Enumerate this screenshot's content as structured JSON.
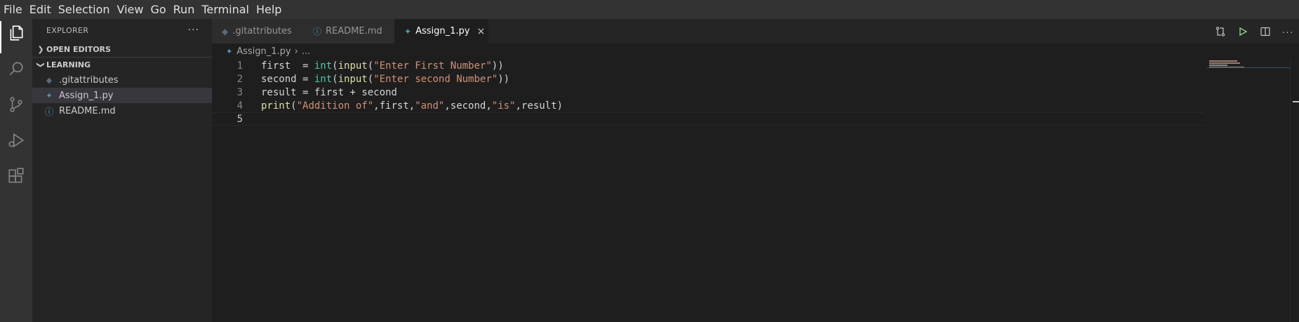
{
  "menubar": {
    "items": [
      "File",
      "Edit",
      "Selection",
      "View",
      "Go",
      "Run",
      "Terminal",
      "Help"
    ]
  },
  "activitybar": {
    "items": [
      "explorer-icon",
      "search-icon",
      "source-control-icon",
      "run-debug-icon",
      "extensions-icon"
    ]
  },
  "sidebar": {
    "title": "EXPLORER",
    "more": "···",
    "open_editors": "OPEN EDITORS",
    "folder": "LEARNING",
    "files": [
      {
        "name": ".gitattributes",
        "icon": "git-file-icon",
        "selected": false
      },
      {
        "name": "Assign_1.py",
        "icon": "python-file-icon",
        "selected": true
      },
      {
        "name": "README.md",
        "icon": "info-file-icon",
        "selected": false
      }
    ]
  },
  "tabs": [
    {
      "label": ".gitattributes",
      "icon": "git-file-icon",
      "active": false
    },
    {
      "label": "README.md",
      "icon": "info-file-icon",
      "active": false
    },
    {
      "label": "Assign_1.py",
      "icon": "python-file-icon",
      "active": true,
      "close": "×"
    }
  ],
  "tab_actions": [
    "compare-changes-icon",
    "run-icon",
    "split-editor-icon",
    "more-actions-icon"
  ],
  "breadcrumb": {
    "file": "Assign_1.py",
    "separator": "›",
    "rest": "..."
  },
  "editor": {
    "lines": [
      {
        "num": "1",
        "tokens": [
          {
            "t": "first  = ",
            "c": "plain"
          },
          {
            "t": "int",
            "c": "builtin"
          },
          {
            "t": "(",
            "c": "plain"
          },
          {
            "t": "input",
            "c": "fn"
          },
          {
            "t": "(",
            "c": "plain"
          },
          {
            "t": "\"Enter First Number\"",
            "c": "str"
          },
          {
            "t": "))",
            "c": "plain"
          }
        ]
      },
      {
        "num": "2",
        "tokens": [
          {
            "t": "second = ",
            "c": "plain"
          },
          {
            "t": "int",
            "c": "builtin"
          },
          {
            "t": "(",
            "c": "plain"
          },
          {
            "t": "input",
            "c": "fn"
          },
          {
            "t": "(",
            "c": "plain"
          },
          {
            "t": "\"Enter second Number\"",
            "c": "str"
          },
          {
            "t": "))",
            "c": "plain"
          }
        ]
      },
      {
        "num": "3",
        "tokens": [
          {
            "t": "result = first + second",
            "c": "plain"
          }
        ]
      },
      {
        "num": "4",
        "tokens": [
          {
            "t": "print",
            "c": "fn"
          },
          {
            "t": "(",
            "c": "plain"
          },
          {
            "t": "\"Addition of\"",
            "c": "str"
          },
          {
            "t": ",first,",
            "c": "plain"
          },
          {
            "t": "\"and\"",
            "c": "str"
          },
          {
            "t": ",second,",
            "c": "plain"
          },
          {
            "t": "\"is\"",
            "c": "str"
          },
          {
            "t": ",result)",
            "c": "plain"
          }
        ]
      },
      {
        "num": "5",
        "tokens": []
      }
    ]
  },
  "colors": {
    "menubar_bg": "#333333",
    "sidebar_bg": "#252526",
    "editor_bg": "#1e1e1e",
    "string": "#ce9178",
    "function": "#dcdcaa",
    "builtin": "#4ec9b0",
    "python_icon": "#519aba"
  }
}
